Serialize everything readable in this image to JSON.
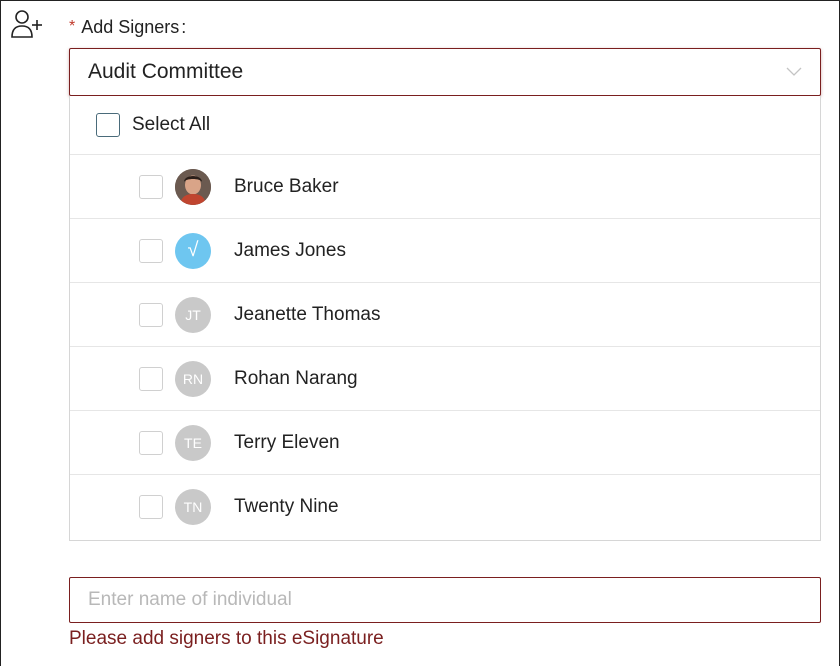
{
  "form": {
    "required_marker": "*",
    "label": "Add Signers",
    "label_colon": ":",
    "icon": "add-user-icon"
  },
  "select": {
    "selected_value": "Audit Committee",
    "icon": "chevron-down-icon"
  },
  "dropdown": {
    "select_all_label": "Select All",
    "items": [
      {
        "name": "Bruce Baker",
        "avatar_type": "photo",
        "avatar_text": ""
      },
      {
        "name": "James Jones",
        "avatar_type": "check",
        "avatar_text": "√"
      },
      {
        "name": "Jeanette Thomas",
        "avatar_type": "initials",
        "avatar_text": "JT"
      },
      {
        "name": "Rohan Narang",
        "avatar_type": "initials",
        "avatar_text": "RN"
      },
      {
        "name": "Terry Eleven",
        "avatar_type": "initials",
        "avatar_text": "TE"
      },
      {
        "name": "Twenty Nine",
        "avatar_type": "initials",
        "avatar_text": "TN"
      }
    ]
  },
  "individual_input": {
    "placeholder": "Enter name of individual",
    "value": ""
  },
  "validation": {
    "error_message": "Please add signers to this eSignature"
  },
  "colors": {
    "error": "#7a1f1f",
    "required": "#c0392b",
    "avatar_initials_bg": "#c9c9c9",
    "avatar_check_bg": "#6ec6f0"
  }
}
